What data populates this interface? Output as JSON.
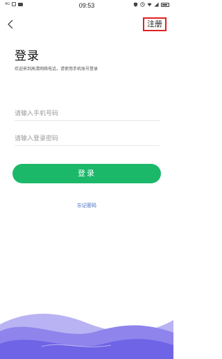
{
  "status_bar": {
    "network": "4G",
    "time": "09:53"
  },
  "header": {
    "register_label": "注册"
  },
  "login": {
    "title": "登录",
    "welcome": "欢迎来到高清网络电话，请使用手机账号登录",
    "phone_placeholder": "请输入手机号码",
    "password_placeholder": "请输入登录密码",
    "login_button": "登录",
    "forgot_password": "忘记密码"
  },
  "colors": {
    "accent_green": "#1bb86a",
    "link_blue": "#3a66c4",
    "highlight_red": "#e02020",
    "wave_purple": "#6f63e6"
  }
}
